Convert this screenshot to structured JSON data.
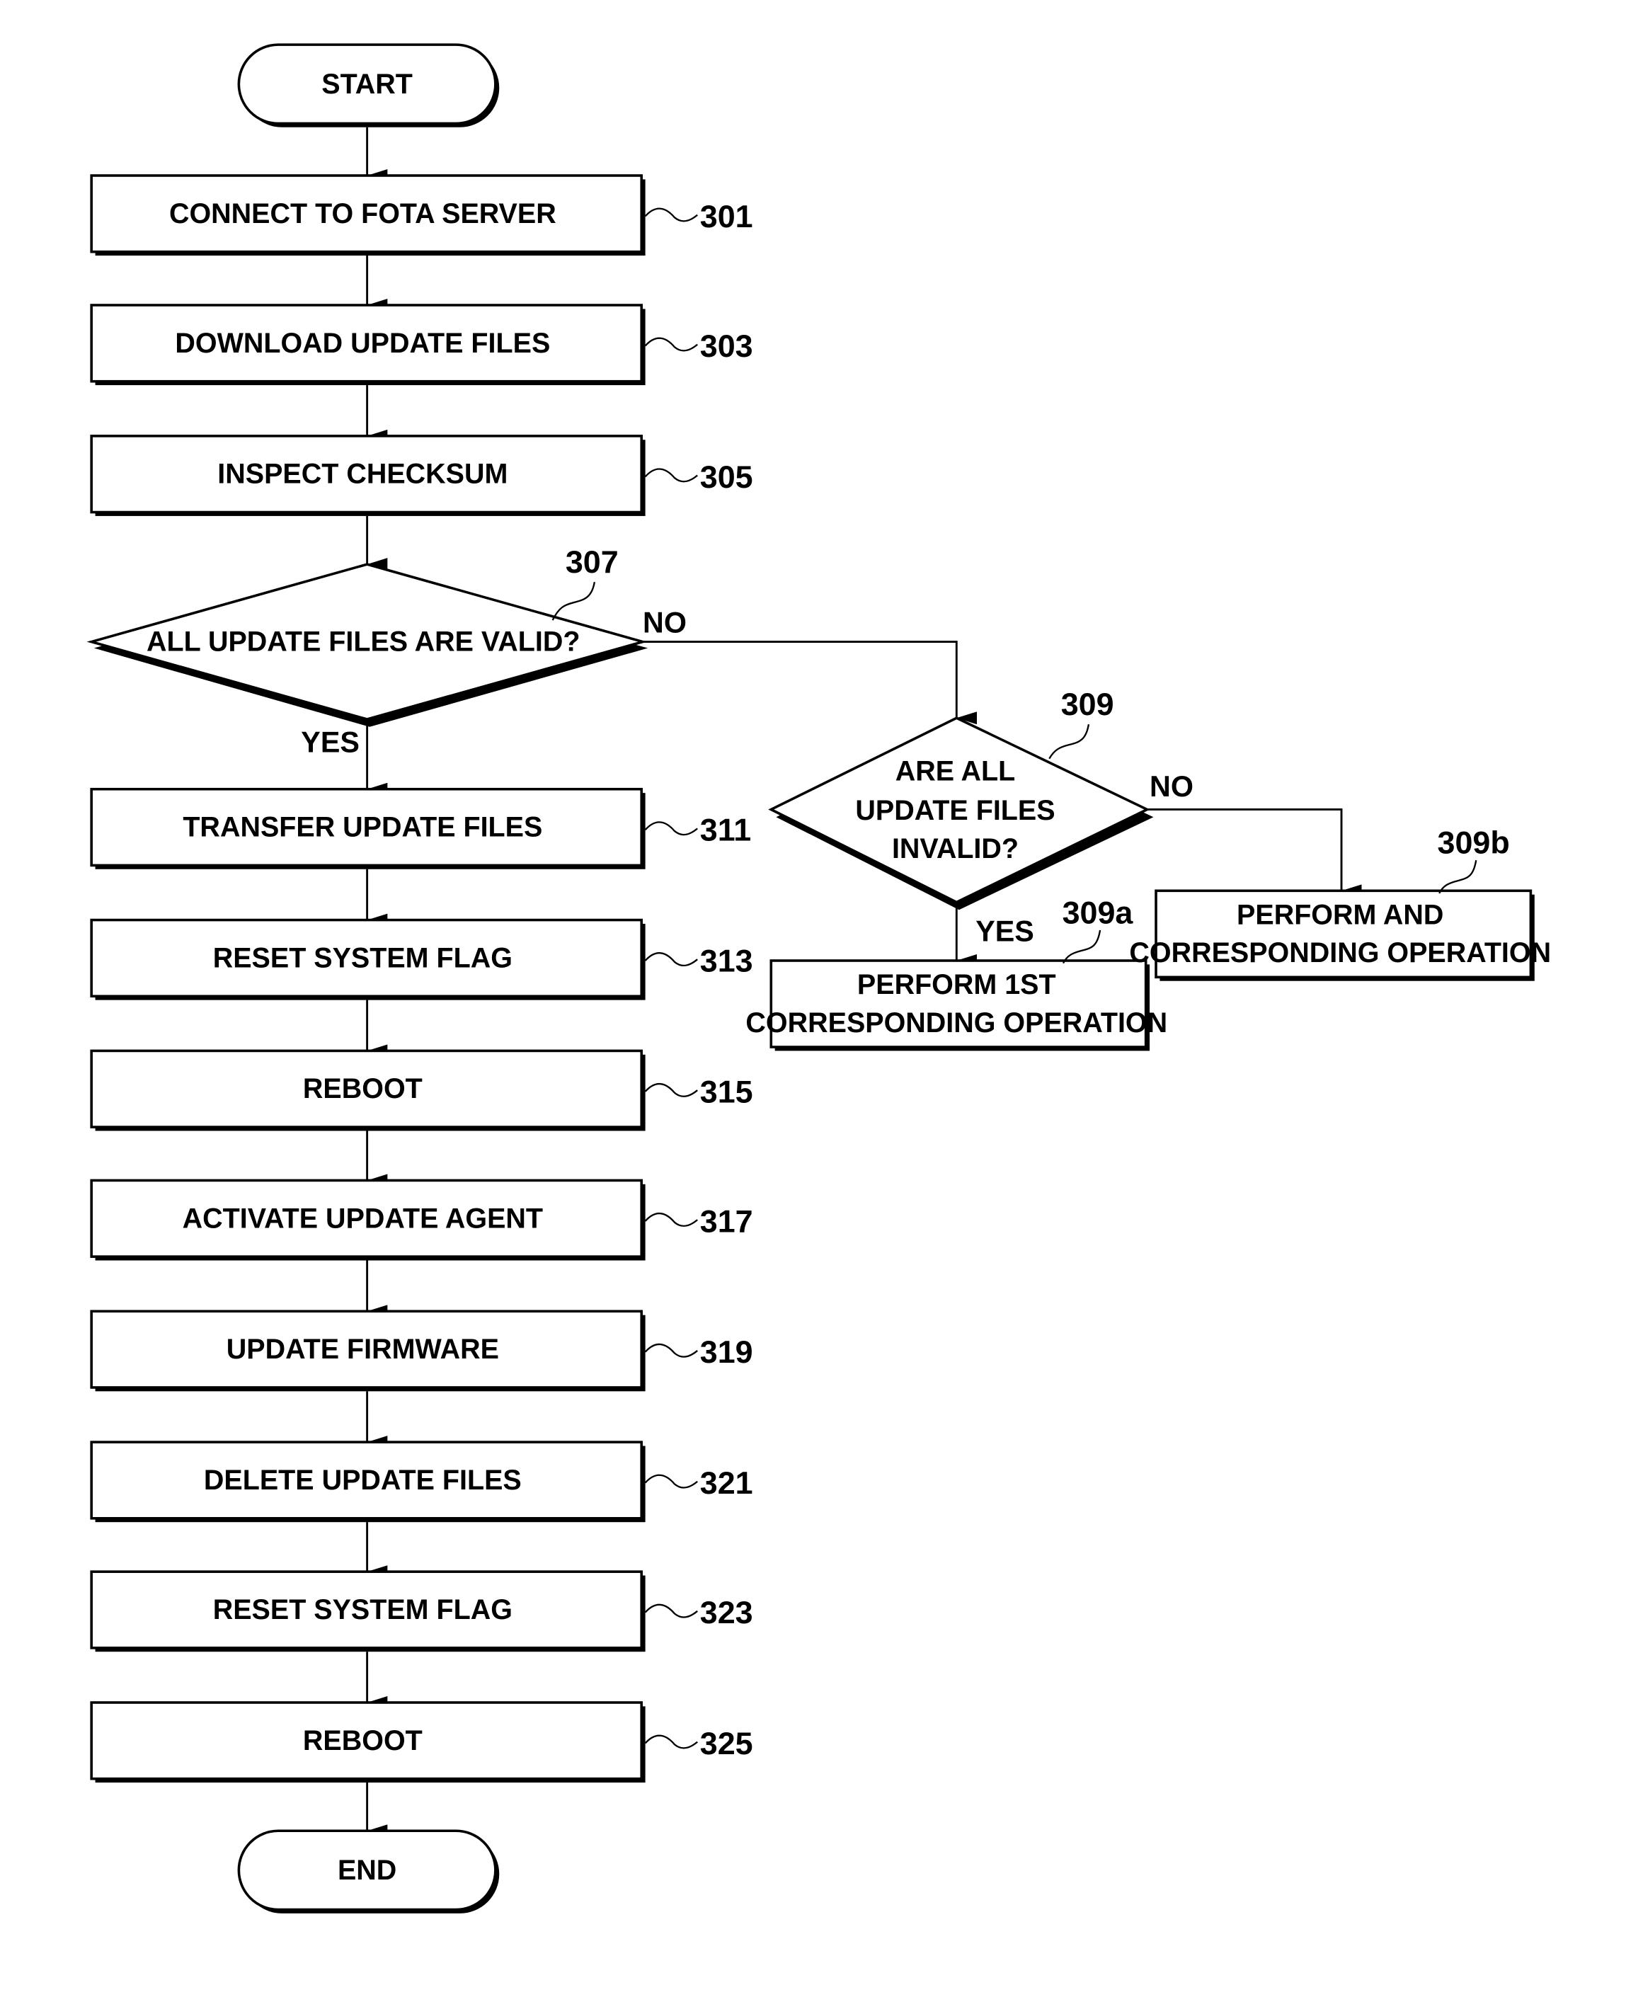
{
  "terminals": {
    "start": "START",
    "end": "END"
  },
  "main_steps": [
    {
      "ref": "301",
      "label": "CONNECT TO FOTA SERVER"
    },
    {
      "ref": "303",
      "label": "DOWNLOAD UPDATE FILES"
    },
    {
      "ref": "305",
      "label": "INSPECT CHECKSUM"
    },
    {
      "ref": "311",
      "label": "TRANSFER UPDATE FILES"
    },
    {
      "ref": "313",
      "label": "RESET SYSTEM FLAG"
    },
    {
      "ref": "315",
      "label": "REBOOT"
    },
    {
      "ref": "317",
      "label": "ACTIVATE UPDATE AGENT"
    },
    {
      "ref": "319",
      "label": "UPDATE FIRMWARE"
    },
    {
      "ref": "321",
      "label": "DELETE UPDATE FILES"
    },
    {
      "ref": "323",
      "label": "RESET SYSTEM FLAG"
    },
    {
      "ref": "325",
      "label": "REBOOT"
    }
  ],
  "decision_307": {
    "ref": "307",
    "label": "ALL UPDATE FILES ARE VALID?",
    "yes": "YES",
    "no": "NO"
  },
  "decision_309": {
    "ref": "309",
    "lines": [
      "ARE ALL",
      "UPDATE FILES",
      "INVALID?"
    ],
    "yes": "YES",
    "no": "NO"
  },
  "step_309a": {
    "ref": "309a",
    "lines": [
      "PERFORM 1ST",
      "CORRESPONDING OPERATION"
    ]
  },
  "step_309b": {
    "ref": "309b",
    "lines": [
      "PERFORM AND",
      "CORRESPONDING OPERATION"
    ]
  }
}
